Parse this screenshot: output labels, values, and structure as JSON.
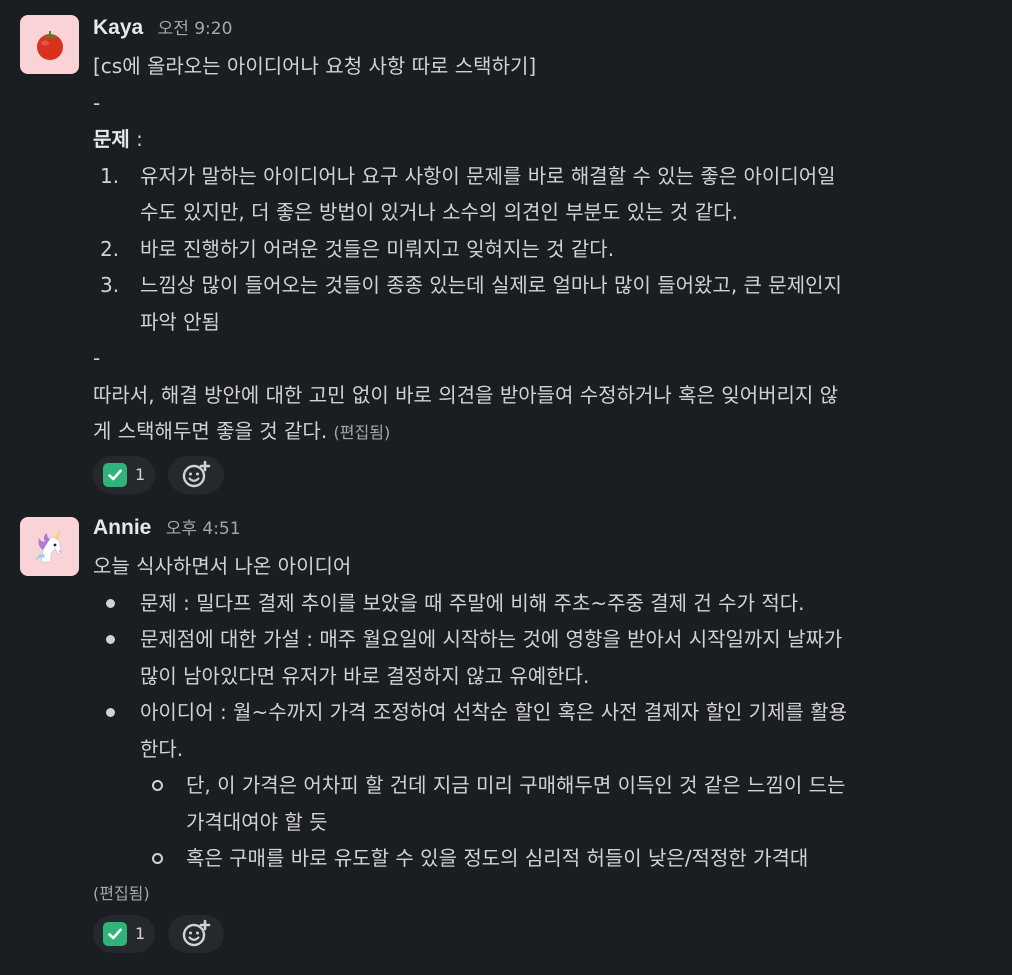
{
  "messages": [
    {
      "author": "Kaya",
      "time": "오전 9:20",
      "avatar_icon": "tomato-icon",
      "title_line": "[cs에 올라오는 아이디어나 요청 사항 따로 스택하기]",
      "separator": "-",
      "problem_label": "문제",
      "problem_colon": " :",
      "problems": [
        {
          "num": "1.",
          "lines": [
            "유저가 말하는 아이디어나 요구 사항이 문제를 바로 해결할 수 있는 좋은 아이디어일",
            "수도 있지만, 더 좋은 방법이 있거나 소수의 의견인 부분도 있는 것 같다."
          ]
        },
        {
          "num": "2.",
          "lines": [
            "바로 진행하기 어려운 것들은 미뤄지고 잊혀지는 것 같다."
          ]
        },
        {
          "num": "3.",
          "lines": [
            "느낌상 많이 들어오는 것들이 종종 있는데 실제로 얼마나 많이 들어왔고, 큰 문제인지",
            "파악 안됨"
          ]
        }
      ],
      "separator2": "-",
      "conclusion_line1": "따라서, 해결 방안에 대한 고민 없이 바로 의견을 받아들여 수정하거나 혹은 잊어버리지 않",
      "conclusion_line2": "게 스택해두면 좋을 것 같다.",
      "edited": "(편집됨)",
      "reaction": {
        "emoji": "white-check-mark",
        "count": "1"
      }
    },
    {
      "author": "Annie",
      "time": "오후 4:51",
      "avatar_icon": "unicorn-icon",
      "intro": "오늘 식사하면서 나온 아이디어",
      "bullets": [
        {
          "lines": [
            "문제 : 밀다프 결제 추이를 보았을 때 주말에 비해 주초~주중 결제 건 수가 적다."
          ]
        },
        {
          "lines": [
            "문제점에 대한 가설 : 매주 월요일에 시작하는 것에 영향을 받아서 시작일까지 날짜가",
            "많이 남아있다면 유저가 바로 결정하지 않고 유예한다."
          ]
        },
        {
          "lines": [
            "아이디어 : 월~수까지 가격 조정하여 선착순 할인 혹은 사전 결제자 할인 기제를 활용",
            "한다."
          ]
        }
      ],
      "sub_bullets": [
        {
          "lines": [
            "단, 이 가격은 어차피 할 건데 지금 미리 구매해두면 이득인 것 같은 느낌이 드는",
            "가격대여야 할 듯"
          ]
        },
        {
          "lines": [
            "혹은 구매를 바로 유도할 수 있을 정도의 심리적 허들이 낮은/적정한 가격대"
          ]
        }
      ],
      "edited": "(편집됨)",
      "reaction": {
        "emoji": "white-check-mark",
        "count": "1"
      }
    }
  ],
  "colors": {
    "background": "#1a1d21",
    "text": "#d1d2d3",
    "muted": "#a6a7a8",
    "reaction_bg": "#25282c",
    "check_green": "#2eb47a",
    "avatar_bg": "#f9d3d6"
  }
}
